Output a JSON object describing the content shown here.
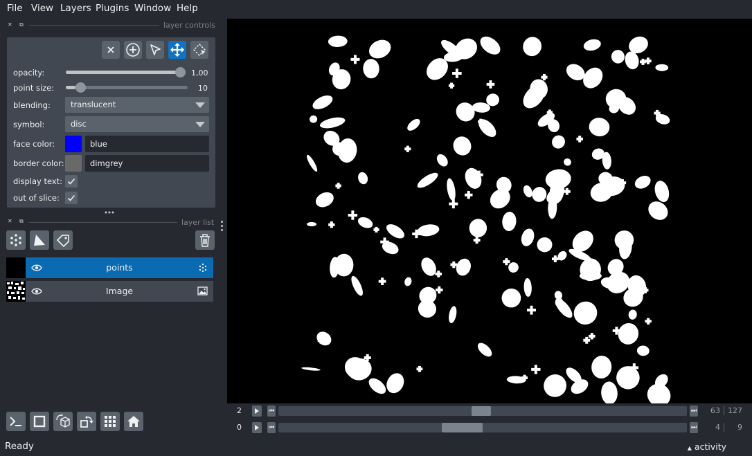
{
  "menu": [
    "File",
    "View",
    "Layers",
    "Plugins",
    "Window",
    "Help"
  ],
  "dock": {
    "controls_title": "layer controls",
    "list_title": "layer list"
  },
  "controls": {
    "mode_buttons": [
      "delete-selected",
      "add-points",
      "select-points",
      "pan-zoom",
      "transform"
    ],
    "active_mode": "pan-zoom",
    "opacity": {
      "label": "opacity:",
      "value": 1.0,
      "display": "1,00"
    },
    "point_size": {
      "label": "point size:",
      "value": 10,
      "display": "10",
      "range": [
        1,
        100
      ]
    },
    "blending": {
      "label": "blending:",
      "value": "translucent"
    },
    "symbol": {
      "label": "symbol:",
      "value": "disc"
    },
    "face_color": {
      "label": "face color:",
      "value": "blue",
      "swatch": "#0000ff"
    },
    "border_color": {
      "label": "border color:",
      "value": "dimgrey",
      "swatch": "#696969"
    },
    "display_text": {
      "label": "display text:",
      "checked": true
    },
    "out_of_slice": {
      "label": "out of slice:",
      "checked": true
    }
  },
  "layers": [
    {
      "name": "points",
      "selected": true,
      "visible": true,
      "icon": "points-icon"
    },
    {
      "name": "Image",
      "selected": false,
      "visible": true,
      "icon": "image-icon"
    }
  ],
  "dims": [
    {
      "axis": "2",
      "current": "63",
      "max": "127",
      "position_fraction": 0.496
    },
    {
      "axis": "0",
      "current": "4",
      "max": "9",
      "position_fraction": 0.444
    }
  ],
  "status": {
    "text": "Ready",
    "activity": "activity"
  },
  "colors": {
    "selected_layer": "#0a6ab2",
    "active_mode": "#1172c2",
    "background": "#262930"
  }
}
